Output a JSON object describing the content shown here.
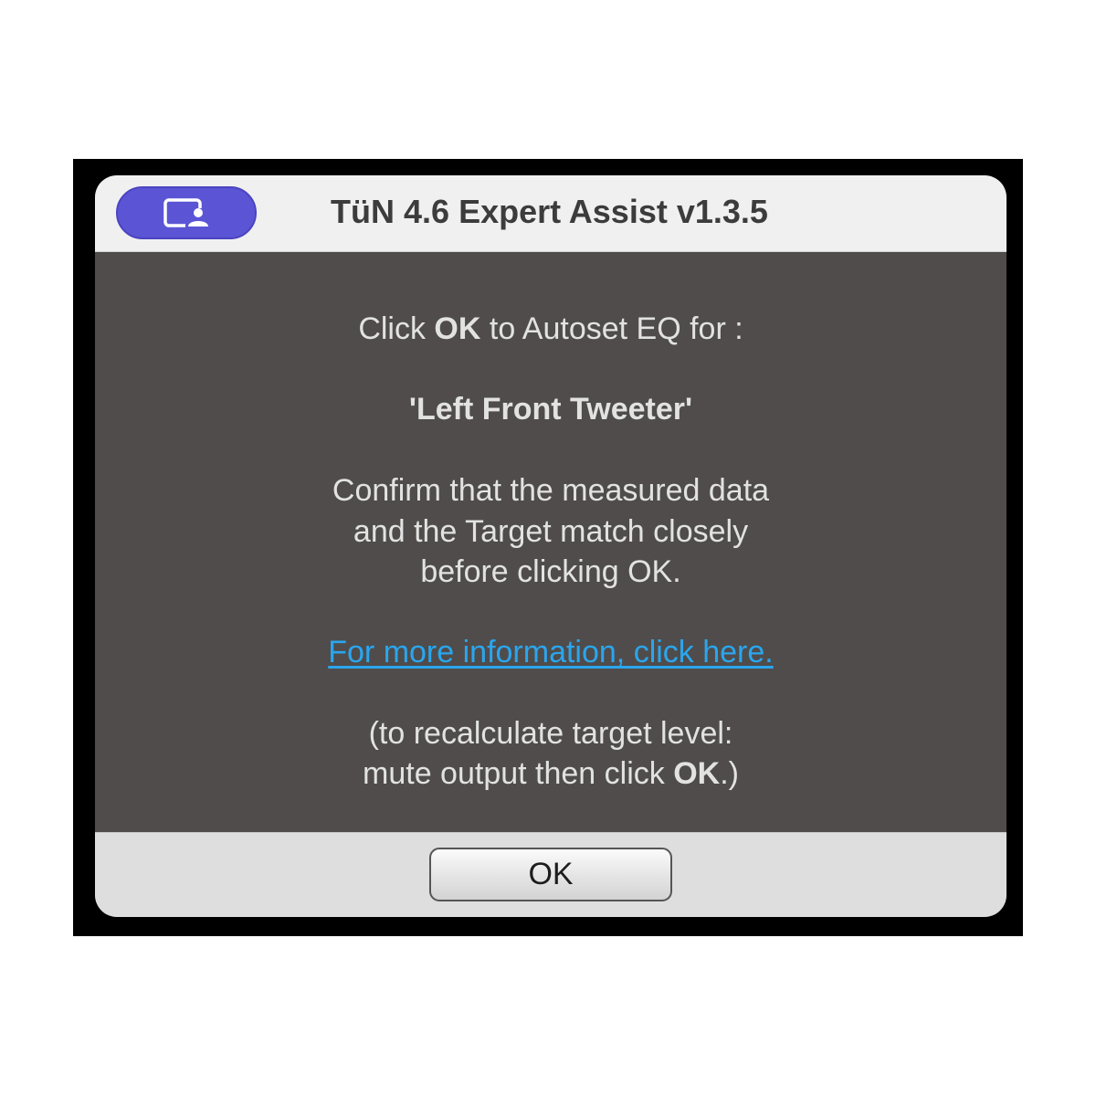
{
  "window": {
    "title": "TüN 4.6 Expert Assist v1.3.5",
    "app_icon": "screen-share-person-icon",
    "badge_color": "#5b55d6"
  },
  "message": {
    "line1_pre": "Click ",
    "line1_bold": "OK",
    "line1_post": " to Autoset EQ for :",
    "speaker": "'Left Front Tweeter'",
    "confirm_lines": [
      "Confirm that the measured data",
      "and the Target match closely",
      "before clicking OK."
    ],
    "link_text": "For more information, click here.",
    "recalc_line1": "(to recalculate target level:",
    "recalc_line2_pre": "mute output then click ",
    "recalc_line2_bold": "OK",
    "recalc_line2_post": ".)"
  },
  "footer": {
    "ok_label": "OK"
  },
  "colors": {
    "content_bg": "#4f4c4b",
    "text": "#e2e2e2",
    "link": "#2aa6ee"
  }
}
